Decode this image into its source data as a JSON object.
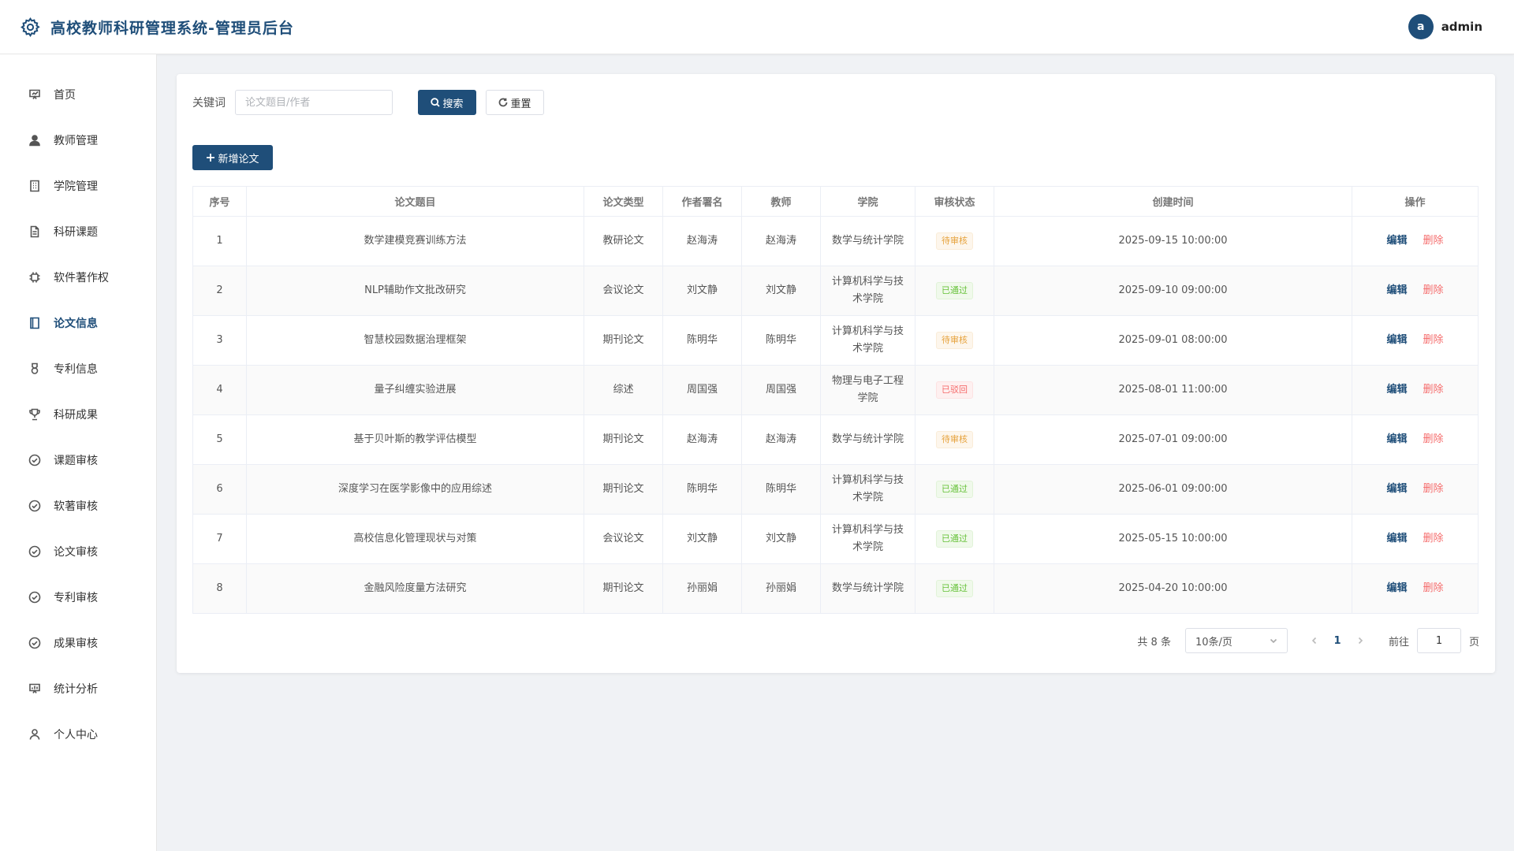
{
  "header": {
    "title": "高校教师科研管理系统-管理员后台",
    "avatar_letter": "a",
    "username": "admin"
  },
  "sidebar": {
    "items": [
      {
        "label": "首页",
        "icon": "dashboard-icon"
      },
      {
        "label": "教师管理",
        "icon": "user-icon"
      },
      {
        "label": "学院管理",
        "icon": "building-icon"
      },
      {
        "label": "科研课题",
        "icon": "document-icon"
      },
      {
        "label": "软件著作权",
        "icon": "cpu-icon"
      },
      {
        "label": "论文信息",
        "icon": "book-icon",
        "active": true
      },
      {
        "label": "专利信息",
        "icon": "medal-icon"
      },
      {
        "label": "科研成果",
        "icon": "trophy-icon"
      },
      {
        "label": "课题审核",
        "icon": "check-circle-icon"
      },
      {
        "label": "软著审核",
        "icon": "check-circle-icon"
      },
      {
        "label": "论文审核",
        "icon": "check-circle-icon"
      },
      {
        "label": "专利审核",
        "icon": "check-circle-icon"
      },
      {
        "label": "成果审核",
        "icon": "check-circle-icon"
      },
      {
        "label": "统计分析",
        "icon": "chart-icon"
      },
      {
        "label": "个人中心",
        "icon": "profile-icon"
      }
    ]
  },
  "search": {
    "label": "关键词",
    "placeholder": "论文题目/作者",
    "value": "",
    "search_button": "搜索",
    "reset_button": "重置",
    "add_button": "新增论文"
  },
  "table": {
    "columns": [
      "序号",
      "论文题目",
      "论文类型",
      "作者署名",
      "教师",
      "学院",
      "审核状态",
      "创建时间",
      "操作"
    ],
    "rows": [
      {
        "no": "1",
        "title": "数学建模竞赛训练方法",
        "type": "教研论文",
        "author": "赵海涛",
        "teacher": "赵海涛",
        "college": "数学与统计学院",
        "status": "待审核",
        "status_kind": "pending",
        "created": "2025-09-15 10:00:00"
      },
      {
        "no": "2",
        "title": "NLP辅助作文批改研究",
        "type": "会议论文",
        "author": "刘文静",
        "teacher": "刘文静",
        "college": "计算机科学与技术学院",
        "status": "已通过",
        "status_kind": "approved",
        "created": "2025-09-10 09:00:00"
      },
      {
        "no": "3",
        "title": "智慧校园数据治理框架",
        "type": "期刊论文",
        "author": "陈明华",
        "teacher": "陈明华",
        "college": "计算机科学与技术学院",
        "status": "待审核",
        "status_kind": "pending",
        "created": "2025-09-01 08:00:00"
      },
      {
        "no": "4",
        "title": "量子纠缠实验进展",
        "type": "综述",
        "author": "周国强",
        "teacher": "周国强",
        "college": "物理与电子工程学院",
        "status": "已驳回",
        "status_kind": "rejected",
        "created": "2025-08-01 11:00:00"
      },
      {
        "no": "5",
        "title": "基于贝叶斯的教学评估模型",
        "type": "期刊论文",
        "author": "赵海涛",
        "teacher": "赵海涛",
        "college": "数学与统计学院",
        "status": "待审核",
        "status_kind": "pending",
        "created": "2025-07-01 09:00:00"
      },
      {
        "no": "6",
        "title": "深度学习在医学影像中的应用综述",
        "type": "期刊论文",
        "author": "陈明华",
        "teacher": "陈明华",
        "college": "计算机科学与技术学院",
        "status": "已通过",
        "status_kind": "approved",
        "created": "2025-06-01 09:00:00"
      },
      {
        "no": "7",
        "title": "高校信息化管理现状与对策",
        "type": "会议论文",
        "author": "刘文静",
        "teacher": "刘文静",
        "college": "计算机科学与技术学院",
        "status": "已通过",
        "status_kind": "approved",
        "created": "2025-05-15 10:00:00"
      },
      {
        "no": "8",
        "title": "金融风险度量方法研究",
        "type": "期刊论文",
        "author": "孙丽娟",
        "teacher": "孙丽娟",
        "college": "数学与统计学院",
        "status": "已通过",
        "status_kind": "approved",
        "created": "2025-04-20 10:00:00"
      }
    ],
    "edit_label": "编辑",
    "delete_label": "删除"
  },
  "pagination": {
    "total_text": "共 8 条",
    "page_size": "10条/页",
    "current_page": "1",
    "goto_label": "前往",
    "goto_value": "1",
    "goto_suffix": "页"
  },
  "colors": {
    "primary": "#1f4e79",
    "pending": "#e6a23c",
    "approved": "#67c23a",
    "rejected": "#f56c6c"
  }
}
